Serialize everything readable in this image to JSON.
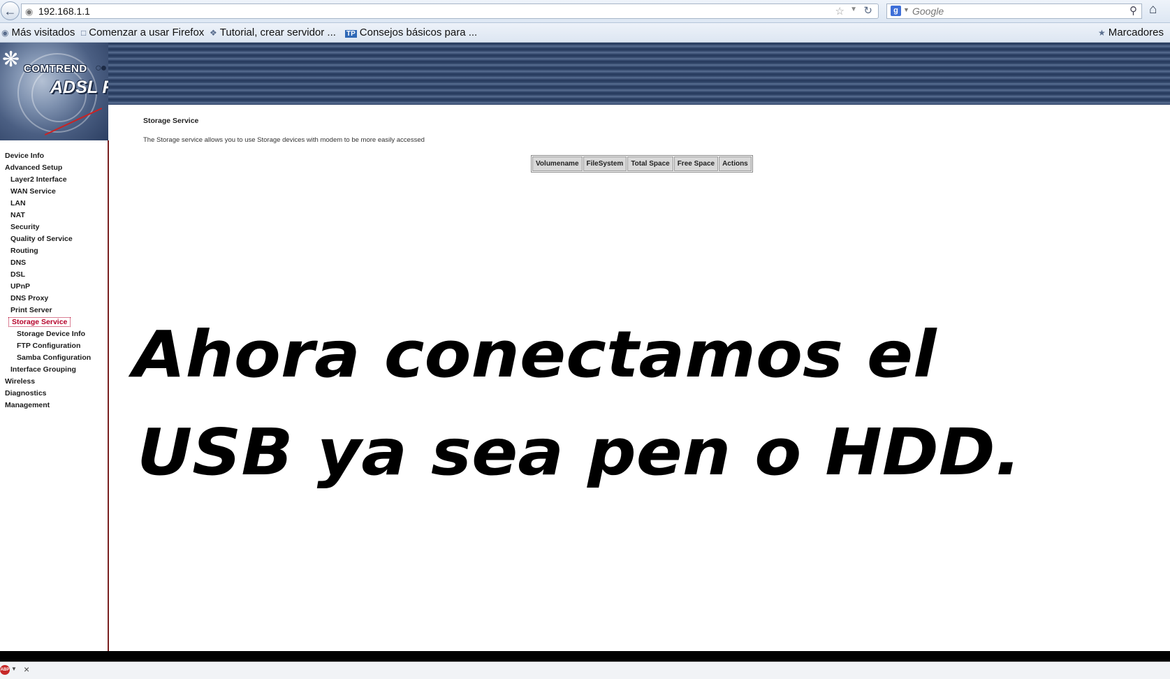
{
  "browser": {
    "url": "192.168.1.1",
    "search_placeholder": "Google",
    "bookmarks": [
      {
        "label": "Más visitados",
        "icon": "globe-icon"
      },
      {
        "label": "Comenzar a usar Firefox",
        "icon": "page-icon"
      },
      {
        "label": "Tutorial, crear servidor ...",
        "icon": "link-icon"
      },
      {
        "label": "Consejos básicos para ...",
        "icon": "tp-icon"
      }
    ],
    "bookmarks_menu": "Marcadores"
  },
  "header": {
    "brand": "COMTREND",
    "product": "ADSL Router"
  },
  "sidebar": {
    "items": [
      {
        "label": "Device Info",
        "level": 0
      },
      {
        "label": "Advanced Setup",
        "level": 0
      },
      {
        "label": "Layer2 Interface",
        "level": 1
      },
      {
        "label": "WAN Service",
        "level": 1
      },
      {
        "label": "LAN",
        "level": 1
      },
      {
        "label": "NAT",
        "level": 1
      },
      {
        "label": "Security",
        "level": 1
      },
      {
        "label": "Quality of Service",
        "level": 1
      },
      {
        "label": "Routing",
        "level": 1
      },
      {
        "label": "DNS",
        "level": 1
      },
      {
        "label": "DSL",
        "level": 1
      },
      {
        "label": "UPnP",
        "level": 1
      },
      {
        "label": "DNS Proxy",
        "level": 1
      },
      {
        "label": "Print Server",
        "level": 1
      },
      {
        "label": "Storage Service",
        "level": 1,
        "active": true
      },
      {
        "label": "Storage Device Info",
        "level": 2
      },
      {
        "label": "FTP Configuration",
        "level": 2
      },
      {
        "label": "Samba Configuration",
        "level": 2
      },
      {
        "label": "Interface Grouping",
        "level": 1
      },
      {
        "label": "Wireless",
        "level": 0
      },
      {
        "label": "Diagnostics",
        "level": 0
      },
      {
        "label": "Management",
        "level": 0
      }
    ]
  },
  "main": {
    "title": "Storage Service",
    "description": "The Storage service allows you to use Storage devices with modem to be more easily accessed",
    "table": {
      "columns": [
        "Volumename",
        "FileSystem",
        "Total Space",
        "Free Space",
        "Actions"
      ],
      "rows": []
    }
  },
  "overlay": {
    "line1": "Ahora conectamos el",
    "line2": "USB ya sea pen o HDD."
  },
  "colors": {
    "active_nav": "#b5002a",
    "header_blue": "#32476b"
  }
}
